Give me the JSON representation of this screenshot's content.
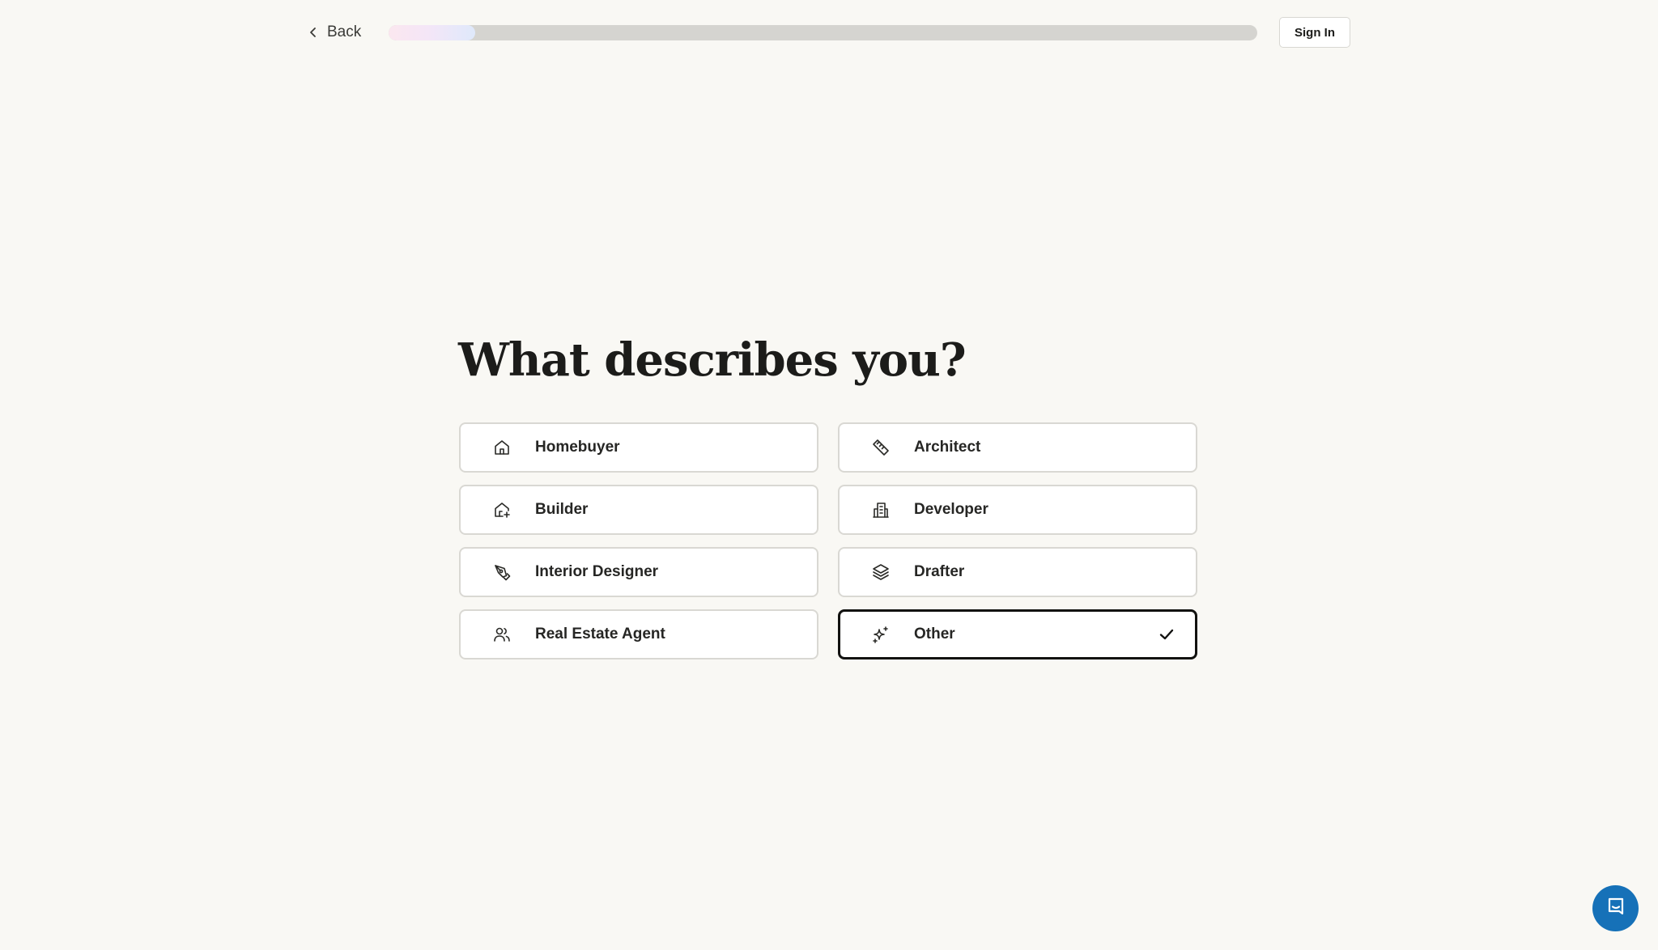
{
  "header": {
    "back_label": "Back",
    "progress_percent": 10,
    "sign_in_label": "Sign In"
  },
  "main": {
    "title": "What describes you?",
    "options": [
      {
        "label": "Homebuyer",
        "icon": "home-icon",
        "selected": false
      },
      {
        "label": "Architect",
        "icon": "ruler-icon",
        "selected": false
      },
      {
        "label": "Builder",
        "icon": "house-plus-icon",
        "selected": false
      },
      {
        "label": "Developer",
        "icon": "building-icon",
        "selected": false
      },
      {
        "label": "Interior Designer",
        "icon": "pen-tool-icon",
        "selected": false
      },
      {
        "label": "Drafter",
        "icon": "layers-icon",
        "selected": false
      },
      {
        "label": "Real Estate Agent",
        "icon": "users-icon",
        "selected": false
      },
      {
        "label": "Other",
        "icon": "sparkles-icon",
        "selected": true
      }
    ]
  },
  "chat": {
    "icon": "chat-icon",
    "color": "#1671b8"
  },
  "colors": {
    "background": "#f9f8f4",
    "selected_border": "#121210",
    "card_border": "#d9d8d3"
  }
}
